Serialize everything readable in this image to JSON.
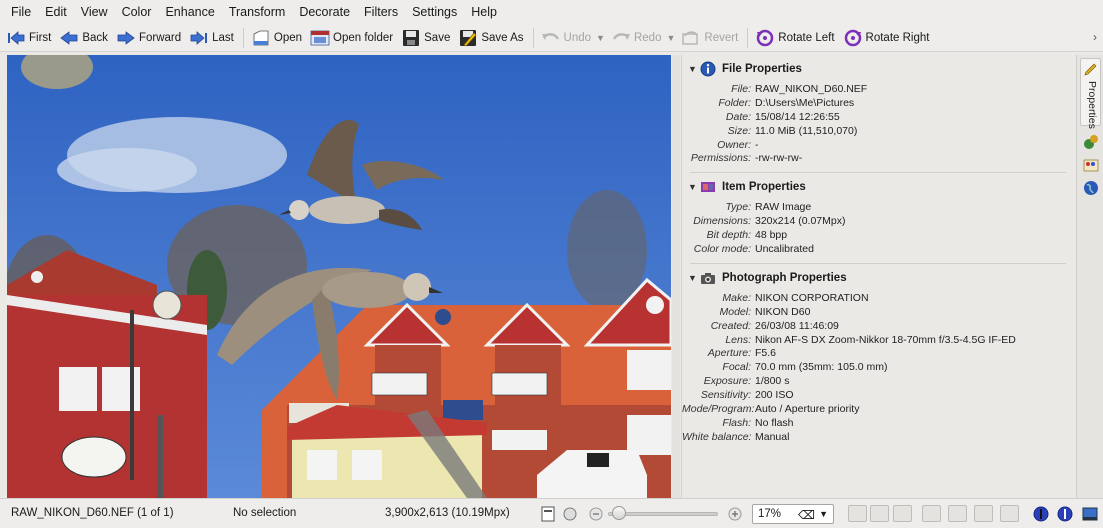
{
  "menu": [
    "File",
    "Edit",
    "View",
    "Color",
    "Enhance",
    "Transform",
    "Decorate",
    "Filters",
    "Settings",
    "Help"
  ],
  "toolbar": {
    "first": "First",
    "back": "Back",
    "forward": "Forward",
    "last": "Last",
    "open": "Open",
    "open_folder": "Open folder",
    "save": "Save",
    "save_as": "Save As",
    "undo": "Undo",
    "redo": "Redo",
    "revert": "Revert",
    "rotate_left": "Rotate Left",
    "rotate_right": "Rotate Right"
  },
  "properties": {
    "file": {
      "title": "File Properties",
      "rows": [
        {
          "key": "File:",
          "value": "RAW_NIKON_D60.NEF"
        },
        {
          "key": "Folder:",
          "value": "D:\\Users\\Me\\Pictures"
        },
        {
          "key": "Date:",
          "value": "15/08/14 12:26:55"
        },
        {
          "key": "Size:",
          "value": "11.0 MiB (11,510,070)"
        },
        {
          "key": "Owner:",
          "value": "-"
        },
        {
          "key": "Permissions:",
          "value": "-rw-rw-rw-"
        }
      ]
    },
    "item": {
      "title": "Item Properties",
      "rows": [
        {
          "key": "Type:",
          "value": "RAW Image"
        },
        {
          "key": "Dimensions:",
          "value": "320x214 (0.07Mpx)"
        },
        {
          "key": "Bit depth:",
          "value": "48 bpp"
        },
        {
          "key": "Color mode:",
          "value": "Uncalibrated"
        }
      ]
    },
    "photo": {
      "title": "Photograph Properties",
      "rows": [
        {
          "key": "Make:",
          "value": "NIKON CORPORATION"
        },
        {
          "key": "Model:",
          "value": "NIKON D60"
        },
        {
          "key": "Created:",
          "value": "26/03/08 11:46:09"
        },
        {
          "key": "Lens:",
          "value": "Nikon AF-S DX Zoom-Nikkor 18-70mm f/3.5-4.5G IF-ED"
        },
        {
          "key": "Aperture:",
          "value": "F5.6"
        },
        {
          "key": "Focal:",
          "value": "70.0 mm (35mm: 105.0 mm)"
        },
        {
          "key": "Exposure:",
          "value": "1/800 s"
        },
        {
          "key": "Sensitivity:",
          "value": "200 ISO"
        },
        {
          "key": "Mode/Program:",
          "value": "Auto / Aperture priority"
        },
        {
          "key": "Flash:",
          "value": "No flash"
        },
        {
          "key": "White balance:",
          "value": "Manual"
        }
      ]
    }
  },
  "sidebar": {
    "properties_tab": "Properties"
  },
  "status": {
    "filename": "RAW_NIKON_D60.NEF (1 of 1)",
    "selection": "No selection",
    "dimensions": "3,900x2,613 (10.19Mpx)",
    "zoom": "17%",
    "zoom_level": 0.1
  },
  "colors": {
    "sky": "#3a6fc7",
    "building_red": "#b83232",
    "roof_orange": "#d9623a",
    "accent_blue": "#2b59b8"
  }
}
